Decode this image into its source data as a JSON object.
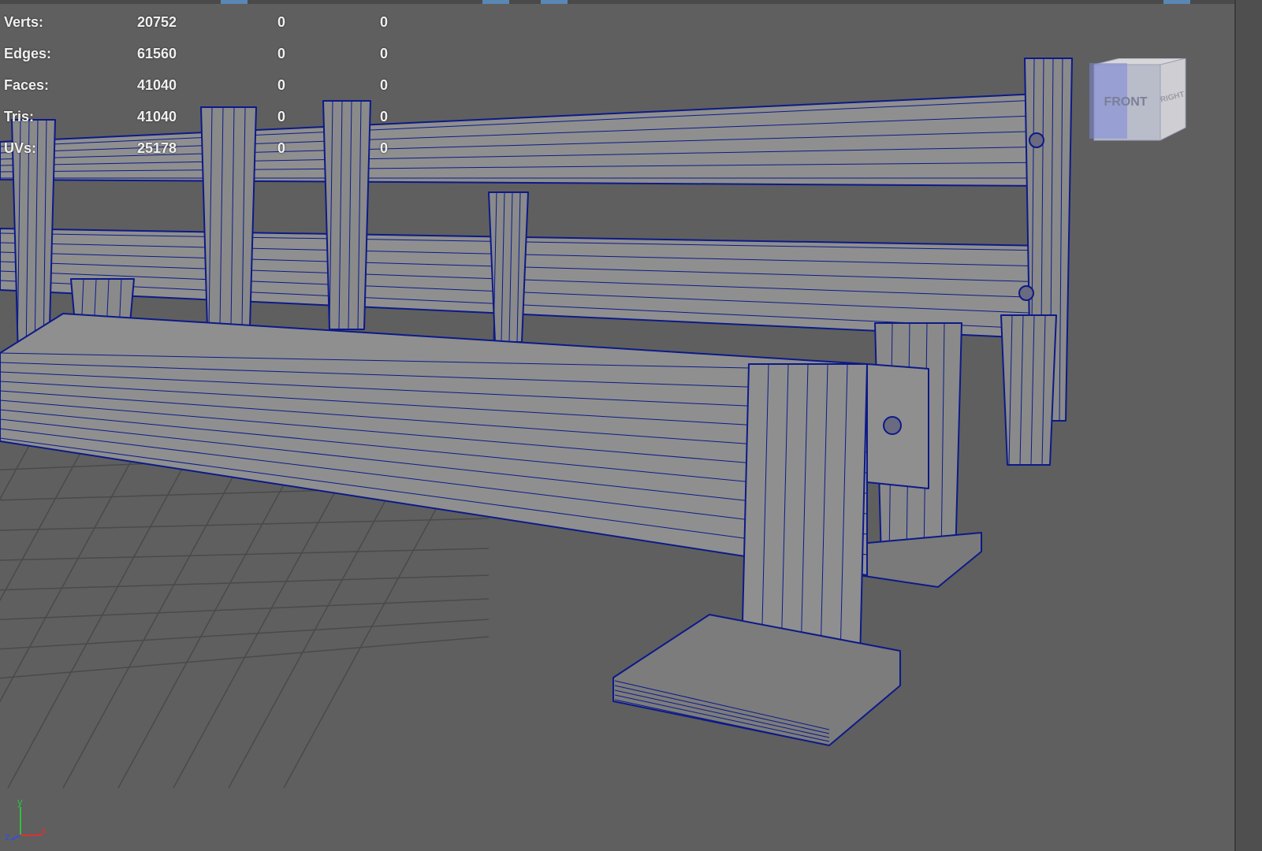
{
  "stats": {
    "rows": [
      {
        "label": "Verts:",
        "v0": "20752",
        "v1": "0",
        "v2": "0"
      },
      {
        "label": "Edges:",
        "v0": "61560",
        "v1": "0",
        "v2": "0"
      },
      {
        "label": "Faces:",
        "v0": "41040",
        "v1": "0",
        "v2": "0"
      },
      {
        "label": "Tris:",
        "v0": "41040",
        "v1": "0",
        "v2": "0"
      },
      {
        "label": "UVs:",
        "v0": "25178",
        "v1": "0",
        "v2": "0"
      }
    ]
  },
  "viewcube": {
    "front_label": "FRONT",
    "right_label": "RIGHT"
  },
  "axis": {
    "x_label": "x",
    "y_label": "y",
    "z_label": "z",
    "x_color": "#e03030",
    "y_color": "#30c040",
    "z_color": "#3050e0"
  },
  "colors": {
    "viewport_bg": "#5f5f5f",
    "wire": "#0c1a88",
    "metal": "#8f8f8f",
    "grid": "#4a4a4a"
  }
}
